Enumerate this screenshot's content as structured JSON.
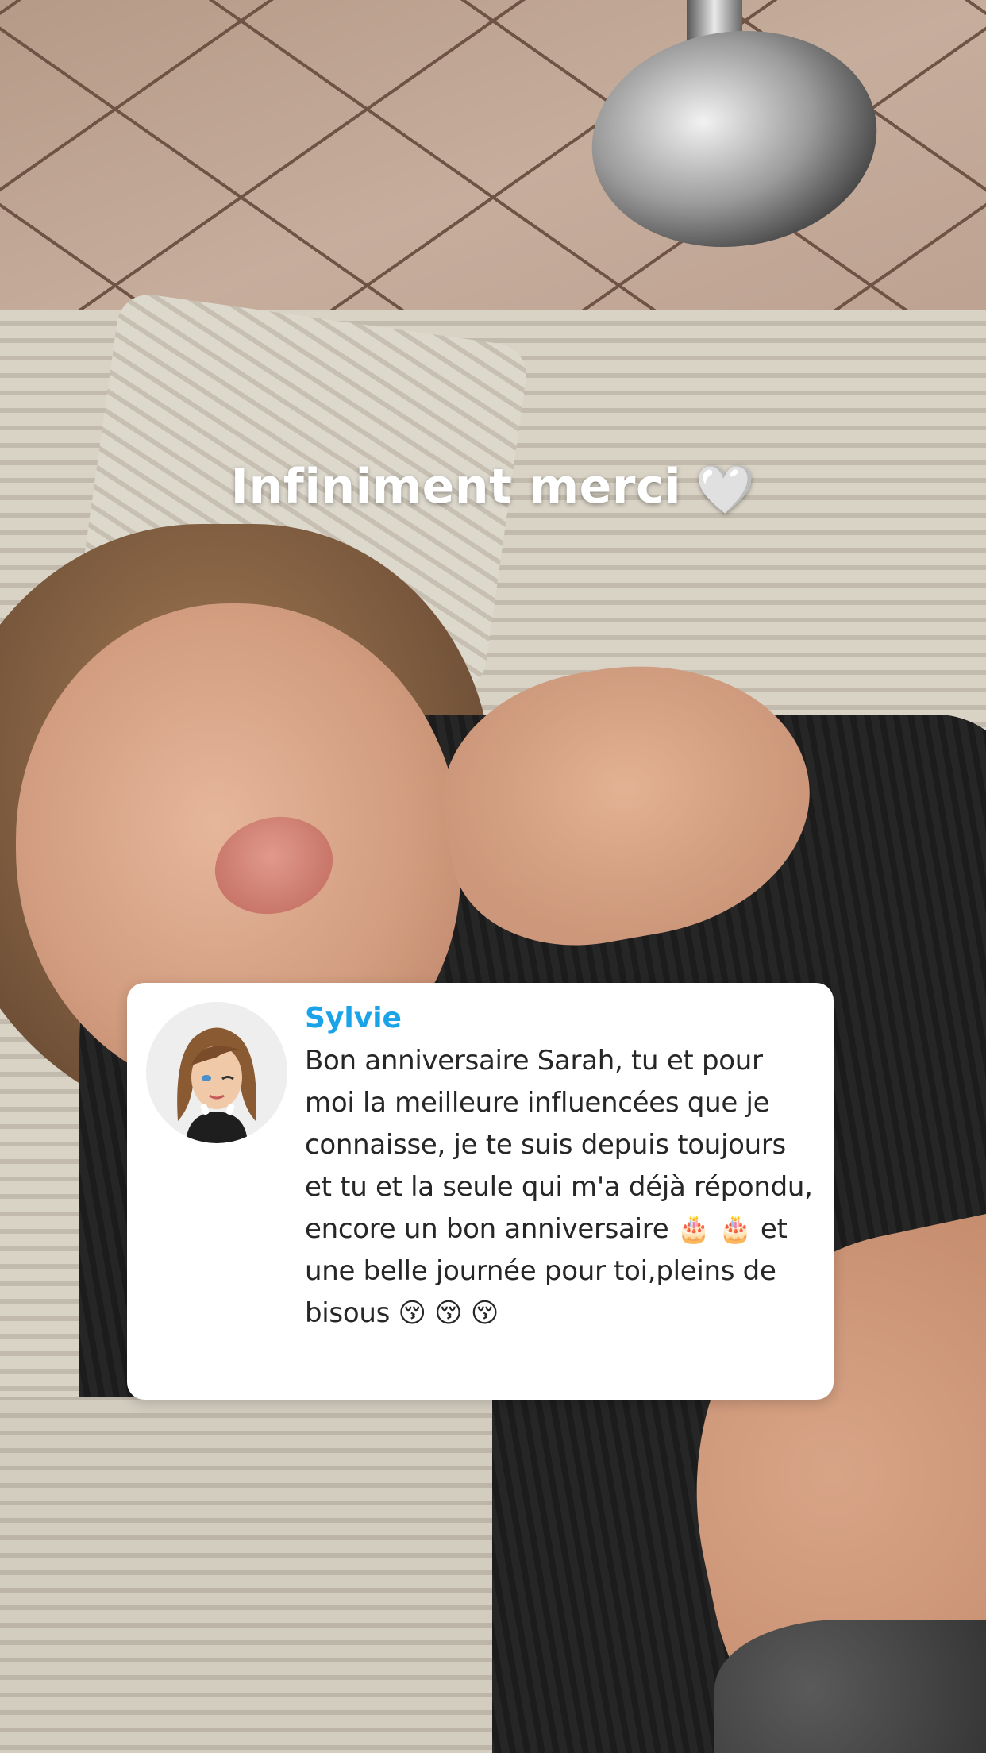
{
  "story": {
    "caption_text": "Infiniment merci",
    "caption_heart": "🤍"
  },
  "reply_card": {
    "sender_name": "Sylvie",
    "message": "Bon anniversaire Sarah, tu et pour moi la meilleure influencées que je connaisse, je te suis depuis toujours et tu et la seule qui m'a déjà répondu, encore un bon anniversaire 🎂 🎂 et une belle journée pour toi,pleins de bisous 😚 😚 😚",
    "avatar_icon": "bitmoji-avatar-icon"
  },
  "colors": {
    "sender_name": "#1aa3e8",
    "card_background": "#ffffff",
    "caption_text": "#ffffff"
  }
}
